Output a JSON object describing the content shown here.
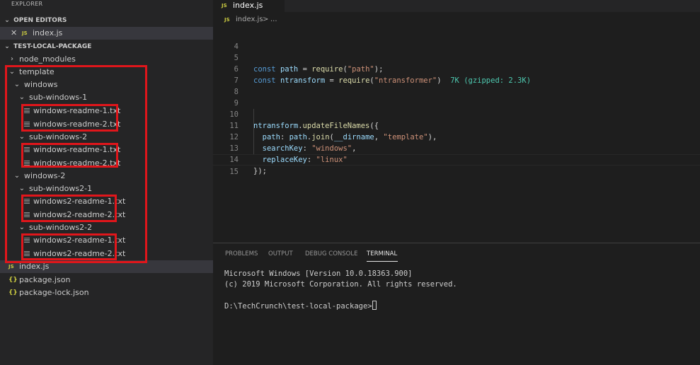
{
  "sidebar": {
    "title": "EXPLORER",
    "open_editors": {
      "header": "OPEN EDITORS",
      "items": [
        {
          "badge": "JS",
          "label": "index.js"
        }
      ]
    },
    "project": {
      "header": "TEST-LOCAL-PACKAGE"
    },
    "tree": {
      "node_modules": "node_modules",
      "template": "template",
      "windows": "windows",
      "sub_windows_1": "sub-windows-1",
      "w_readme_1a": "windows-readme-1.txt",
      "w_readme_2a": "windows-readme-2.txt",
      "sub_windows_2": "sub-windows-2",
      "w_readme_1b": "windows-readme-1.txt",
      "w_readme_2b": "windows-readme-2.txt",
      "windows_2": "windows-2",
      "sub_windows2_1": "sub-windows2-1",
      "w2_readme_1a": "windows2-readme-1.txt",
      "w2_readme_2a": "windows2-readme-2.txt",
      "sub_windows2_2": "sub-windows2-2",
      "w2_readme_1b": "windows2-readme-1.txt",
      "w2_readme_2b": "windows2-readme-2.txt",
      "index_js": "index.js",
      "package_json": "package.json",
      "package_lock": "package-lock.json"
    },
    "badges": {
      "js": "JS",
      "json": "{}"
    }
  },
  "editor": {
    "tab": {
      "badge": "JS",
      "label": "index.js"
    },
    "breadcrumb": {
      "badge": "JS",
      "file": "index.js",
      "separator": ">",
      "more": "..."
    },
    "line_numbers": [
      "4",
      "5",
      "6",
      "7",
      "8",
      "9",
      "10",
      "11",
      "12",
      "13",
      "14",
      "15"
    ],
    "code": {
      "l5_kw": "const",
      "l5_var": "path",
      "l5_eq": "=",
      "l5_fn": "require",
      "l5_str": "\"path\"",
      "l6_kw": "const",
      "l6_var": "ntransform",
      "l6_eq": "=",
      "l6_fn": "require",
      "l6_str": "\"ntransformer\"",
      "l6_hint": "7K (gzipped: 2.3K)",
      "l10_obj": "ntransform",
      "l10_fn": "updateFileNames",
      "l11_key": "path",
      "l11_obj": "path",
      "l11_fn": "join",
      "l11_arg": "__dirname",
      "l11_str": "\"template\"",
      "l12_key": "searchKey",
      "l12_str": "\"windows\"",
      "l13_key": "replaceKey",
      "l13_str": "\"linux\"",
      "l14_close": "});"
    }
  },
  "panel": {
    "tabs": [
      "PROBLEMS",
      "OUTPUT",
      "DEBUG CONSOLE",
      "TERMINAL"
    ],
    "active_tab": "TERMINAL",
    "terminal": {
      "line1": "Microsoft Windows [Version 10.0.18363.900]",
      "line2": "(c) 2019 Microsoft Corporation. All rights reserved.",
      "prompt": "D:\\TechCrunch\\test-local-package>"
    }
  },
  "colors": {
    "highlight_box": "#e0161b",
    "js_badge": "#cbcb41",
    "keyword": "#569cd6",
    "string": "#ce9178"
  }
}
